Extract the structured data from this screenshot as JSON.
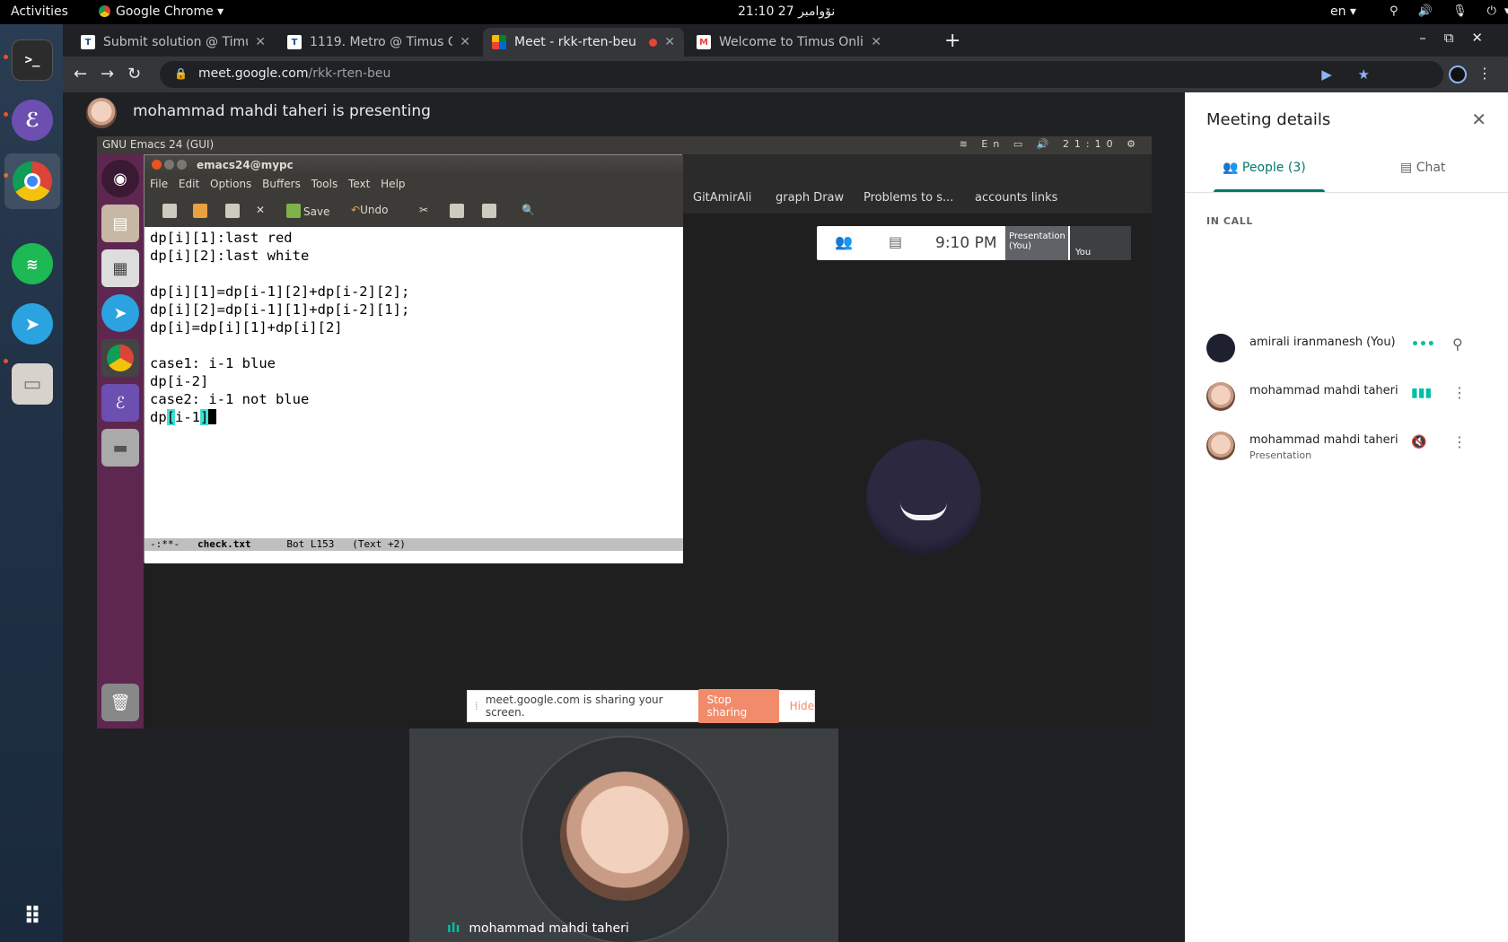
{
  "topbar": {
    "activities": "Activities",
    "app_menu": "Google Chrome ▾",
    "clock": "21:10  27 نۆوامبر",
    "lang": "en ▾",
    "sys_icons": "?🔊🎤⏻▾"
  },
  "dock": {
    "items": [
      "terminal",
      "emacs",
      "chrome",
      "spotify",
      "telegram",
      "files",
      "show-applications"
    ]
  },
  "chrome": {
    "tabs": [
      {
        "title": "Submit solution @ Timus",
        "favicon": "T"
      },
      {
        "title": "1119. Metro @ Timus Onli",
        "favicon": "T"
      },
      {
        "title": "Meet - rkk-rten-beu",
        "favicon": "meet",
        "active": true,
        "recording": true
      },
      {
        "title": "Welcome to Timus Online",
        "favicon": "M"
      }
    ],
    "url_host": "meet.google.com",
    "url_path": "/rkk-rten-beu"
  },
  "meet": {
    "presenting_text": "mohammad mahdi taheri is presenting",
    "share_banner": {
      "text": "meet.google.com is sharing your screen.",
      "stop_label": "Stop sharing",
      "hide_label": "Hide"
    },
    "tile_name": "mohammad mahdi taheri"
  },
  "shared_screen": {
    "top_title": "GNU Emacs 24 (GUI)",
    "top_lang": "En",
    "top_time": "21:10",
    "inner_bookmarks": [
      "GitAmirAli",
      "graph Draw",
      "Problems to s...",
      "accounts links"
    ],
    "inner_time": "9:10 PM",
    "inner_presentation": "Presentation (You)",
    "inner_you": "You"
  },
  "emacs": {
    "window_title": "emacs24@mypc",
    "menu": [
      "File",
      "Edit",
      "Options",
      "Buffers",
      "Tools",
      "Text",
      "Help"
    ],
    "tool_save": "Save",
    "tool_undo": "Undo",
    "lines": [
      "dp[i][1]:last red",
      "dp[i][2]:last white",
      "",
      "dp[i][1]=dp[i-1][2]+dp[i-2][2];",
      "dp[i][2]=dp[i-1][1]+dp[i-2][1];",
      "dp[i]=dp[i][1]+dp[i][2]",
      "",
      "case1: i-1 blue",
      "dp[i-2]",
      "case2: i-1 not blue"
    ],
    "last_line_prefix": "dp",
    "last_line_hl_open": "[",
    "last_line_mid": "i-1",
    "last_line_hl_close": "]",
    "modeline_status": "-:**-",
    "modeline_file": "check.txt",
    "modeline_pos": "Bot L153",
    "modeline_mode": "(Text +2)"
  },
  "panel": {
    "title": "Meeting details",
    "tab_people": "People (3)",
    "tab_chat": "Chat",
    "in_call": "IN CALL",
    "people": [
      {
        "name": "amirali iranmanesh (You)",
        "sub": "",
        "indicator": "•••"
      },
      {
        "name": "mohammad mahdi taheri",
        "sub": "",
        "indicator": "▮▮▮"
      },
      {
        "name": "mohammad mahdi taheri",
        "sub": "Presentation",
        "indicator": "muted"
      }
    ]
  },
  "colors": {
    "meet_teal": "#00796b",
    "stop_sharing": "#f28b6b",
    "ubuntu_launcher": "#5e2750",
    "emacs_highlight": "#40e0d0"
  }
}
